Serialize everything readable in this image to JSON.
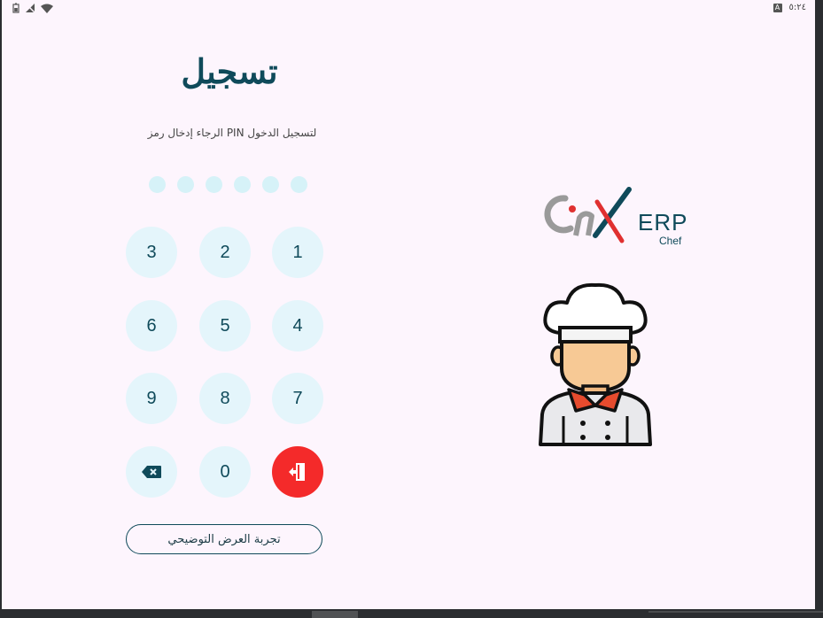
{
  "status_bar": {
    "time": "٥:٢٤",
    "badge": "A",
    "icons": [
      "battery-icon",
      "no-sim-icon",
      "wifi-icon"
    ]
  },
  "login": {
    "title": "تسجيل",
    "subtitle": "الرجاء إدخال رمز PIN لتسجيل الدخول",
    "pin_length": 6,
    "keys": {
      "k1": "1",
      "k2": "2",
      "k3": "3",
      "k4": "4",
      "k5": "5",
      "k6": "6",
      "k7": "7",
      "k8": "8",
      "k9": "9",
      "k0": "0"
    },
    "demo_button": "تجربة العرض التوضيحي"
  },
  "brand": {
    "logo_letters": "OnX",
    "logo_erp": "ERP",
    "logo_sub": "Chef"
  },
  "colors": {
    "primary": "#0f4a5a",
    "key_bg": "#e4f5fb",
    "exit": "#f42a2a",
    "background": "#fdf5fd"
  }
}
